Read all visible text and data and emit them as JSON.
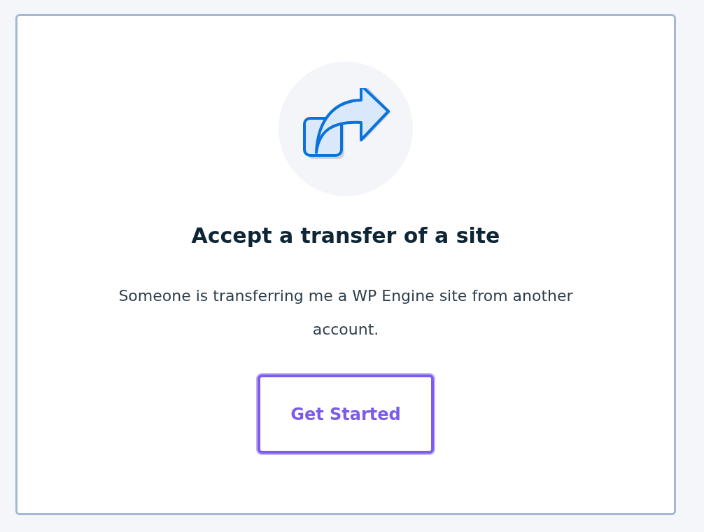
{
  "card": {
    "title": "Accept a transfer of a site",
    "description": "Someone is transferring me a WP Engine site from another account.",
    "button": "Get Started"
  }
}
